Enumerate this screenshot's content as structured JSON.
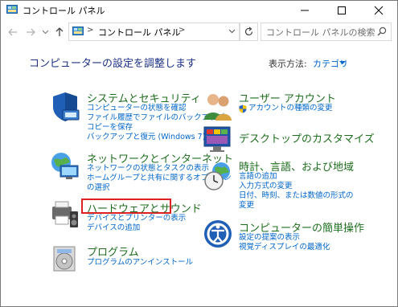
{
  "window": {
    "title": "コントロール パネル"
  },
  "address": {
    "path": "コントロール パネル",
    "search_placeholder": "コントロール パネルの検索"
  },
  "page": {
    "title": "コンピューターの設定を調整します",
    "view_label": "表示方法:",
    "view_value": "カテゴリ"
  },
  "categories": {
    "security": {
      "title": "システムとセキュリティ",
      "links": [
        "コンピューターの状態を確認",
        "ファイル履歴でファイルのバックアップ",
        "コピーを保存",
        "バックアップと復元 (Windows 7)"
      ]
    },
    "network": {
      "title": "ネットワークとインターネット",
      "links": [
        "ネットワークの状態とタスクの表示",
        "ホームグループと共有に関するオプション",
        "の選択"
      ]
    },
    "hardware": {
      "title": "ハードウェアとサウンド",
      "links": [
        "デバイスとプリンターの表示",
        "デバイスの追加"
      ]
    },
    "programs": {
      "title": "プログラム",
      "links": [
        "プログラムのアンインストール"
      ]
    },
    "users": {
      "title": "ユーザー アカウント",
      "links": [
        "アカウントの種類の変更"
      ]
    },
    "desktop": {
      "title": "デスクトップのカスタマイズ",
      "links": []
    },
    "clock": {
      "title": "時計、言語、および地域",
      "links": [
        "言語の追加",
        "入力方式の変更",
        "日付、時刻、または数値の形式の",
        "変更"
      ]
    },
    "ease": {
      "title": "コンピューターの簡単操作",
      "links": [
        "設定の提案の表示",
        "視覚ディスプレイの最適化"
      ]
    }
  },
  "colors": {
    "accent": "#0066cc",
    "category_title": "#1e6e1e",
    "page_title": "#1e3287",
    "highlight": "#e02020"
  }
}
